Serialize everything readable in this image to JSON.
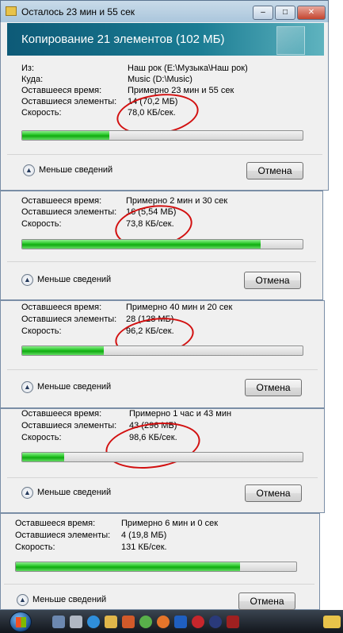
{
  "window": {
    "title": "Осталось 23 мин и 55 сек",
    "header": "Копирование 21 элементов (102 МБ)"
  },
  "labels": {
    "from": "Из:",
    "to": "Куда:",
    "time_left": "Оставшееся время:",
    "items_left": "Оставшиеся элементы:",
    "speed": "Скорость:"
  },
  "dialog1": {
    "from": "Наш рок (E:\\Музыка\\Наш рок)",
    "to": "Music (D:\\Music)",
    "time_left": "Примерно 23 мин и 55 сек",
    "items_left": "14 (70,2 МБ)",
    "speed": "78,0 КБ/сек.",
    "progress": 0.31
  },
  "dialog2": {
    "time_left": "Примерно 2 мин и 30 сек",
    "items_left": "16 (5,54 МБ)",
    "speed": "73,8 КБ/сек.",
    "progress": 0.85
  },
  "dialog3": {
    "time_left": "Примерно 40 мин и 20 сек",
    "items_left": "28 (128 МБ)",
    "speed": "96,2 КБ/сек.",
    "progress": 0.29
  },
  "dialog4": {
    "time_left": "Примерно 1 час и 43 мин",
    "items_left": "43 (296 МБ)",
    "speed": "98,6 КБ/сек.",
    "progress": 0.15
  },
  "dialog5": {
    "time_left": "Примерно 6 мин и 0 сек",
    "items_left": "4 (19,8 МБ)",
    "speed": "131 КБ/сек.",
    "progress": 0.8
  },
  "buttons": {
    "less_details": "Меньше сведений",
    "cancel": "Отмена"
  },
  "icons": {
    "minimize": "minimize-icon",
    "maximize": "maximize-icon",
    "close": "close-icon",
    "less_details": "chevron-up-icon"
  },
  "colors": {
    "header": "#1a7c93",
    "progress": "#22c322",
    "annotation": "#d21010"
  }
}
